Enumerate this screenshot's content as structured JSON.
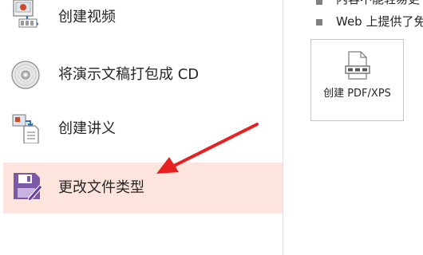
{
  "left_menu": {
    "items": [
      {
        "label": "创建视频",
        "icon": "video-icon"
      },
      {
        "label": "将演示文稿打包成 CD",
        "icon": "cd-icon"
      },
      {
        "label": "创建讲义",
        "icon": "handout-icon"
      },
      {
        "label": "更改文件类型",
        "icon": "save-disk-icon",
        "selected": true
      }
    ]
  },
  "right_pane": {
    "bullets": [
      "内容不能轻易更",
      "Web 上提供了免"
    ],
    "create_pdf_label": "创建 PDF/XPS"
  },
  "colors": {
    "selected_bg": "#fde4dd",
    "annotation_arrow": "#e82020",
    "disk_icon": "#6b3fa0"
  }
}
